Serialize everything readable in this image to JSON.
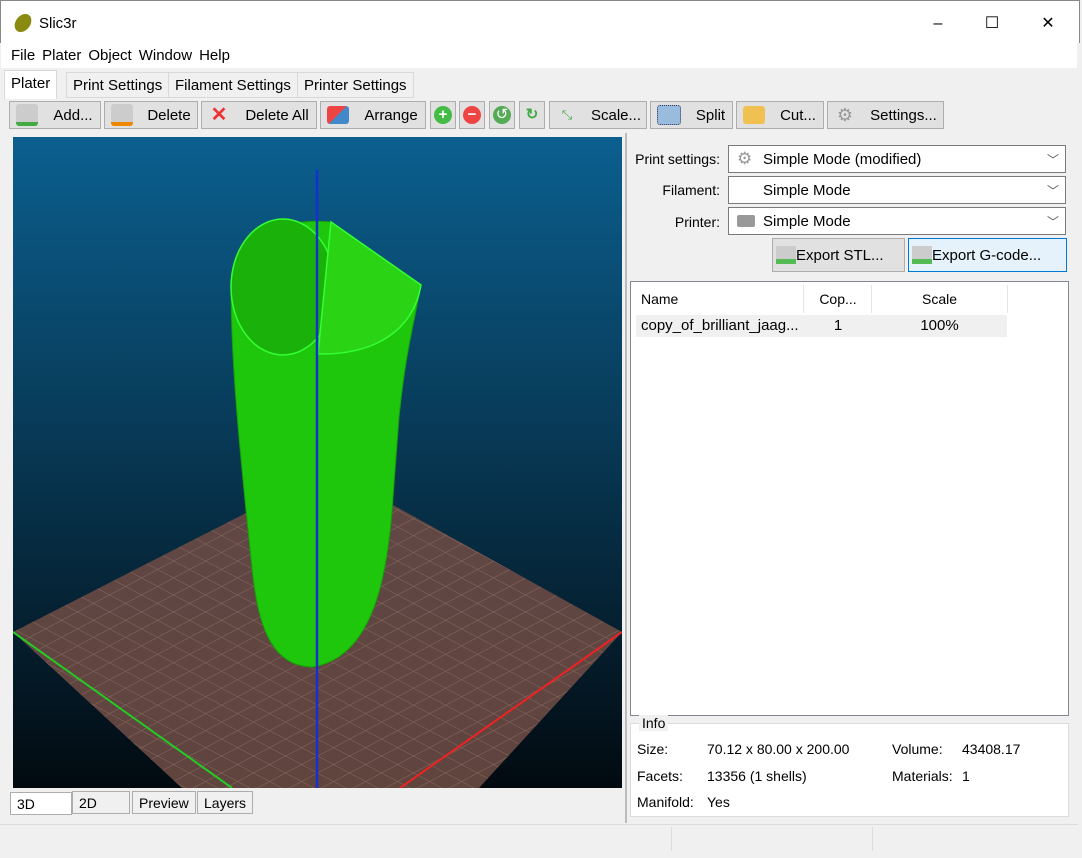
{
  "window": {
    "title": "Slic3r",
    "minimize": "–",
    "maximize": "☐",
    "close": "✕"
  },
  "menu": [
    "File",
    "Plater",
    "Object",
    "Window",
    "Help"
  ],
  "tabs": [
    "Plater",
    "Print Settings",
    "Filament Settings",
    "Printer Settings"
  ],
  "toolbar": {
    "add": "Add...",
    "delete": "Delete",
    "delete_all": "Delete All",
    "arrange": "Arrange",
    "scale": "Scale...",
    "split": "Split",
    "cut": "Cut...",
    "settings": "Settings..."
  },
  "presets": {
    "print_label": "Print settings:",
    "print_value": "Simple Mode (modified)",
    "filament_label": "Filament:",
    "filament_value": "Simple Mode",
    "printer_label": "Printer:",
    "printer_value": "Simple Mode"
  },
  "export": {
    "stl": "Export STL...",
    "gcode": "Export G-code..."
  },
  "objects": {
    "headers": [
      "Name",
      "Cop...",
      "Scale"
    ],
    "rows": [
      {
        "name": "copy_of_brilliant_jaag...",
        "copies": "1",
        "scale": "100%"
      }
    ]
  },
  "info": {
    "title": "Info",
    "size_label": "Size:",
    "size": "70.12 x 80.00 x 200.00",
    "volume_label": "Volume:",
    "volume": "43408.17",
    "facets_label": "Facets:",
    "facets": "13356 (1 shells)",
    "materials_label": "Materials:",
    "materials": "1",
    "manifold_label": "Manifold:",
    "manifold": "Yes"
  },
  "view_tabs": [
    "3D",
    "2D",
    "Preview",
    "Layers"
  ]
}
